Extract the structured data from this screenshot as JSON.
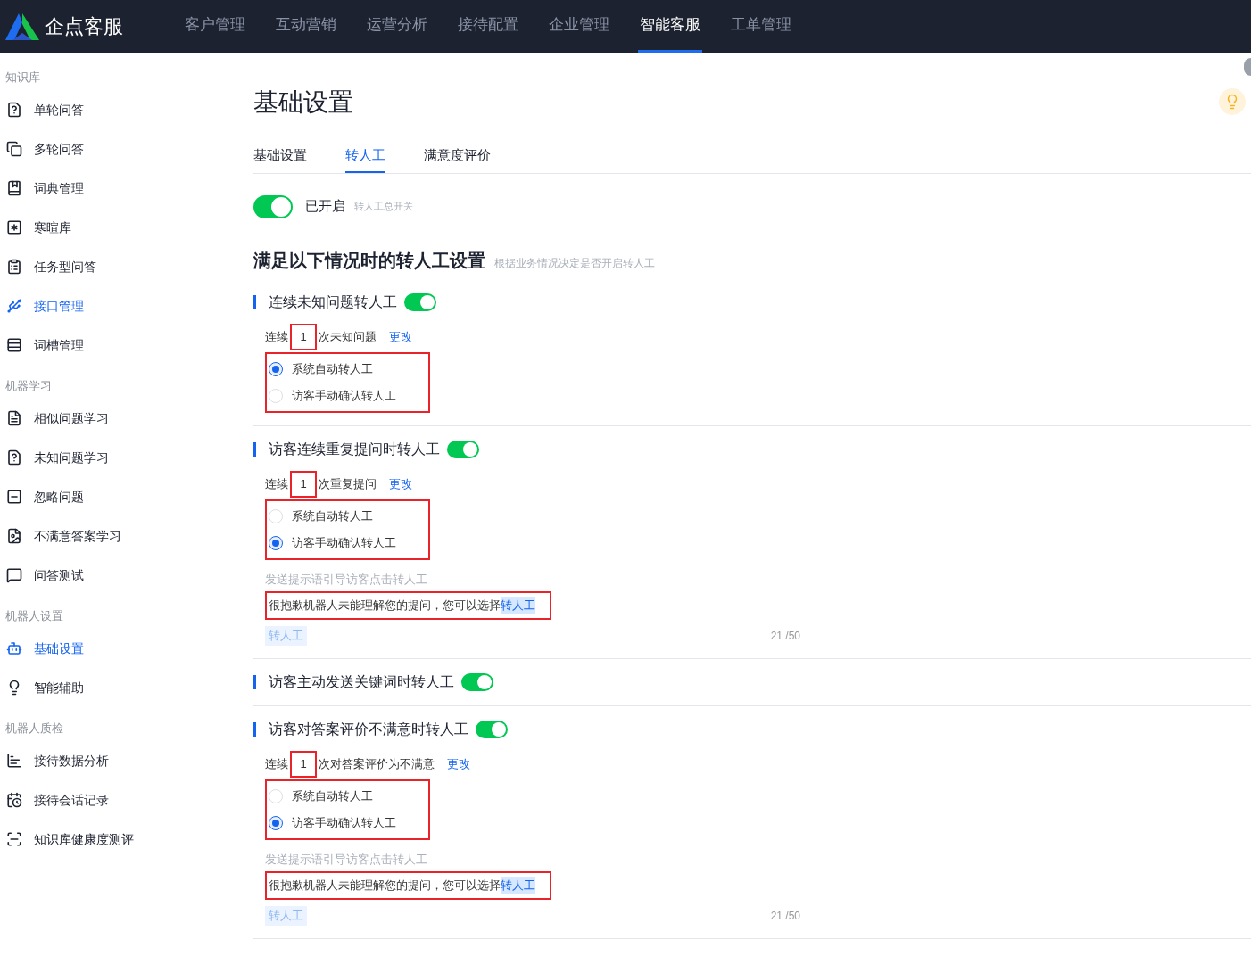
{
  "brand": {
    "name": "企点客服"
  },
  "nav": [
    {
      "label": "客户管理",
      "selected": false
    },
    {
      "label": "互动营销",
      "selected": false
    },
    {
      "label": "运营分析",
      "selected": false
    },
    {
      "label": "接待配置",
      "selected": false
    },
    {
      "label": "企业管理",
      "selected": false
    },
    {
      "label": "智能客服",
      "selected": true
    },
    {
      "label": "工单管理",
      "selected": false
    }
  ],
  "sidebar": [
    {
      "title": "知识库",
      "items": [
        {
          "label": "单轮问答",
          "selected": false
        },
        {
          "label": "多轮问答",
          "selected": false
        },
        {
          "label": "词典管理",
          "selected": false
        },
        {
          "label": "寒暄库",
          "selected": false
        },
        {
          "label": "任务型问答",
          "selected": false
        },
        {
          "label": "接口管理",
          "selected": true
        },
        {
          "label": "词槽管理",
          "selected": false
        }
      ]
    },
    {
      "title": "机器学习",
      "items": [
        {
          "label": "相似问题学习",
          "selected": false
        },
        {
          "label": "未知问题学习",
          "selected": false
        },
        {
          "label": "忽略问题",
          "selected": false
        },
        {
          "label": "不满意答案学习",
          "selected": false
        },
        {
          "label": "问答测试",
          "selected": false
        }
      ]
    },
    {
      "title": "机器人设置",
      "items": [
        {
          "label": "基础设置",
          "selected": true
        },
        {
          "label": "智能辅助",
          "selected": false
        }
      ]
    },
    {
      "title": "机器人质检",
      "items": [
        {
          "label": "接待数据分析",
          "selected": false
        },
        {
          "label": "接待会话记录",
          "selected": false
        },
        {
          "label": "知识库健康度测评",
          "selected": false
        }
      ]
    }
  ],
  "page_title": "基础设置",
  "tabs": [
    {
      "label": "基础设置",
      "selected": false
    },
    {
      "label": "转人工",
      "selected": true
    },
    {
      "label": "满意度评价",
      "selected": false
    }
  ],
  "master_switch": {
    "on": true,
    "label": "已开启",
    "hint": "转人工总开关"
  },
  "section": {
    "title": "满足以下情况时的转人工设置",
    "hint": "根据业务情况决定是否开启转人工"
  },
  "rules": [
    {
      "title": "连续未知问题转人工",
      "on": true,
      "count_prefix": "连续",
      "count": "1",
      "count_suffix": "次未知问题",
      "change_link": "更改",
      "options": [
        {
          "label": "系统自动转人工",
          "selected": true
        },
        {
          "label": "访客手动确认转人工",
          "selected": false
        }
      ]
    },
    {
      "title": "访客连续重复提问时转人工",
      "on": true,
      "count_prefix": "连续",
      "count": "1",
      "count_suffix": "次重复提问",
      "change_link": "更改",
      "options": [
        {
          "label": "系统自动转人工",
          "selected": false
        },
        {
          "label": "访客手动确认转人工",
          "selected": true
        }
      ],
      "prompt": {
        "label": "发送提示语引导访客点击转人工",
        "text": "很抱歉机器人未能理解您的提问，您可以选择",
        "highlight": "转人工",
        "tag": "转人工",
        "counter": "21 /50"
      }
    },
    {
      "title": "访客主动发送关键词时转人工",
      "on": true
    },
    {
      "title": "访客对答案评价不满意时转人工",
      "on": true,
      "count_prefix": "连续",
      "count": "1",
      "count_suffix": "次对答案评价为不满意",
      "change_link": "更改",
      "options": [
        {
          "label": "系统自动转人工",
          "selected": false
        },
        {
          "label": "访客手动确认转人工",
          "selected": true
        }
      ],
      "prompt": {
        "label": "发送提示语引导访客点击转人工",
        "text": "很抱歉机器人未能理解您的提问，您可以选择",
        "highlight": "转人工",
        "tag": "转人工",
        "counter": "21 /50"
      }
    }
  ]
}
